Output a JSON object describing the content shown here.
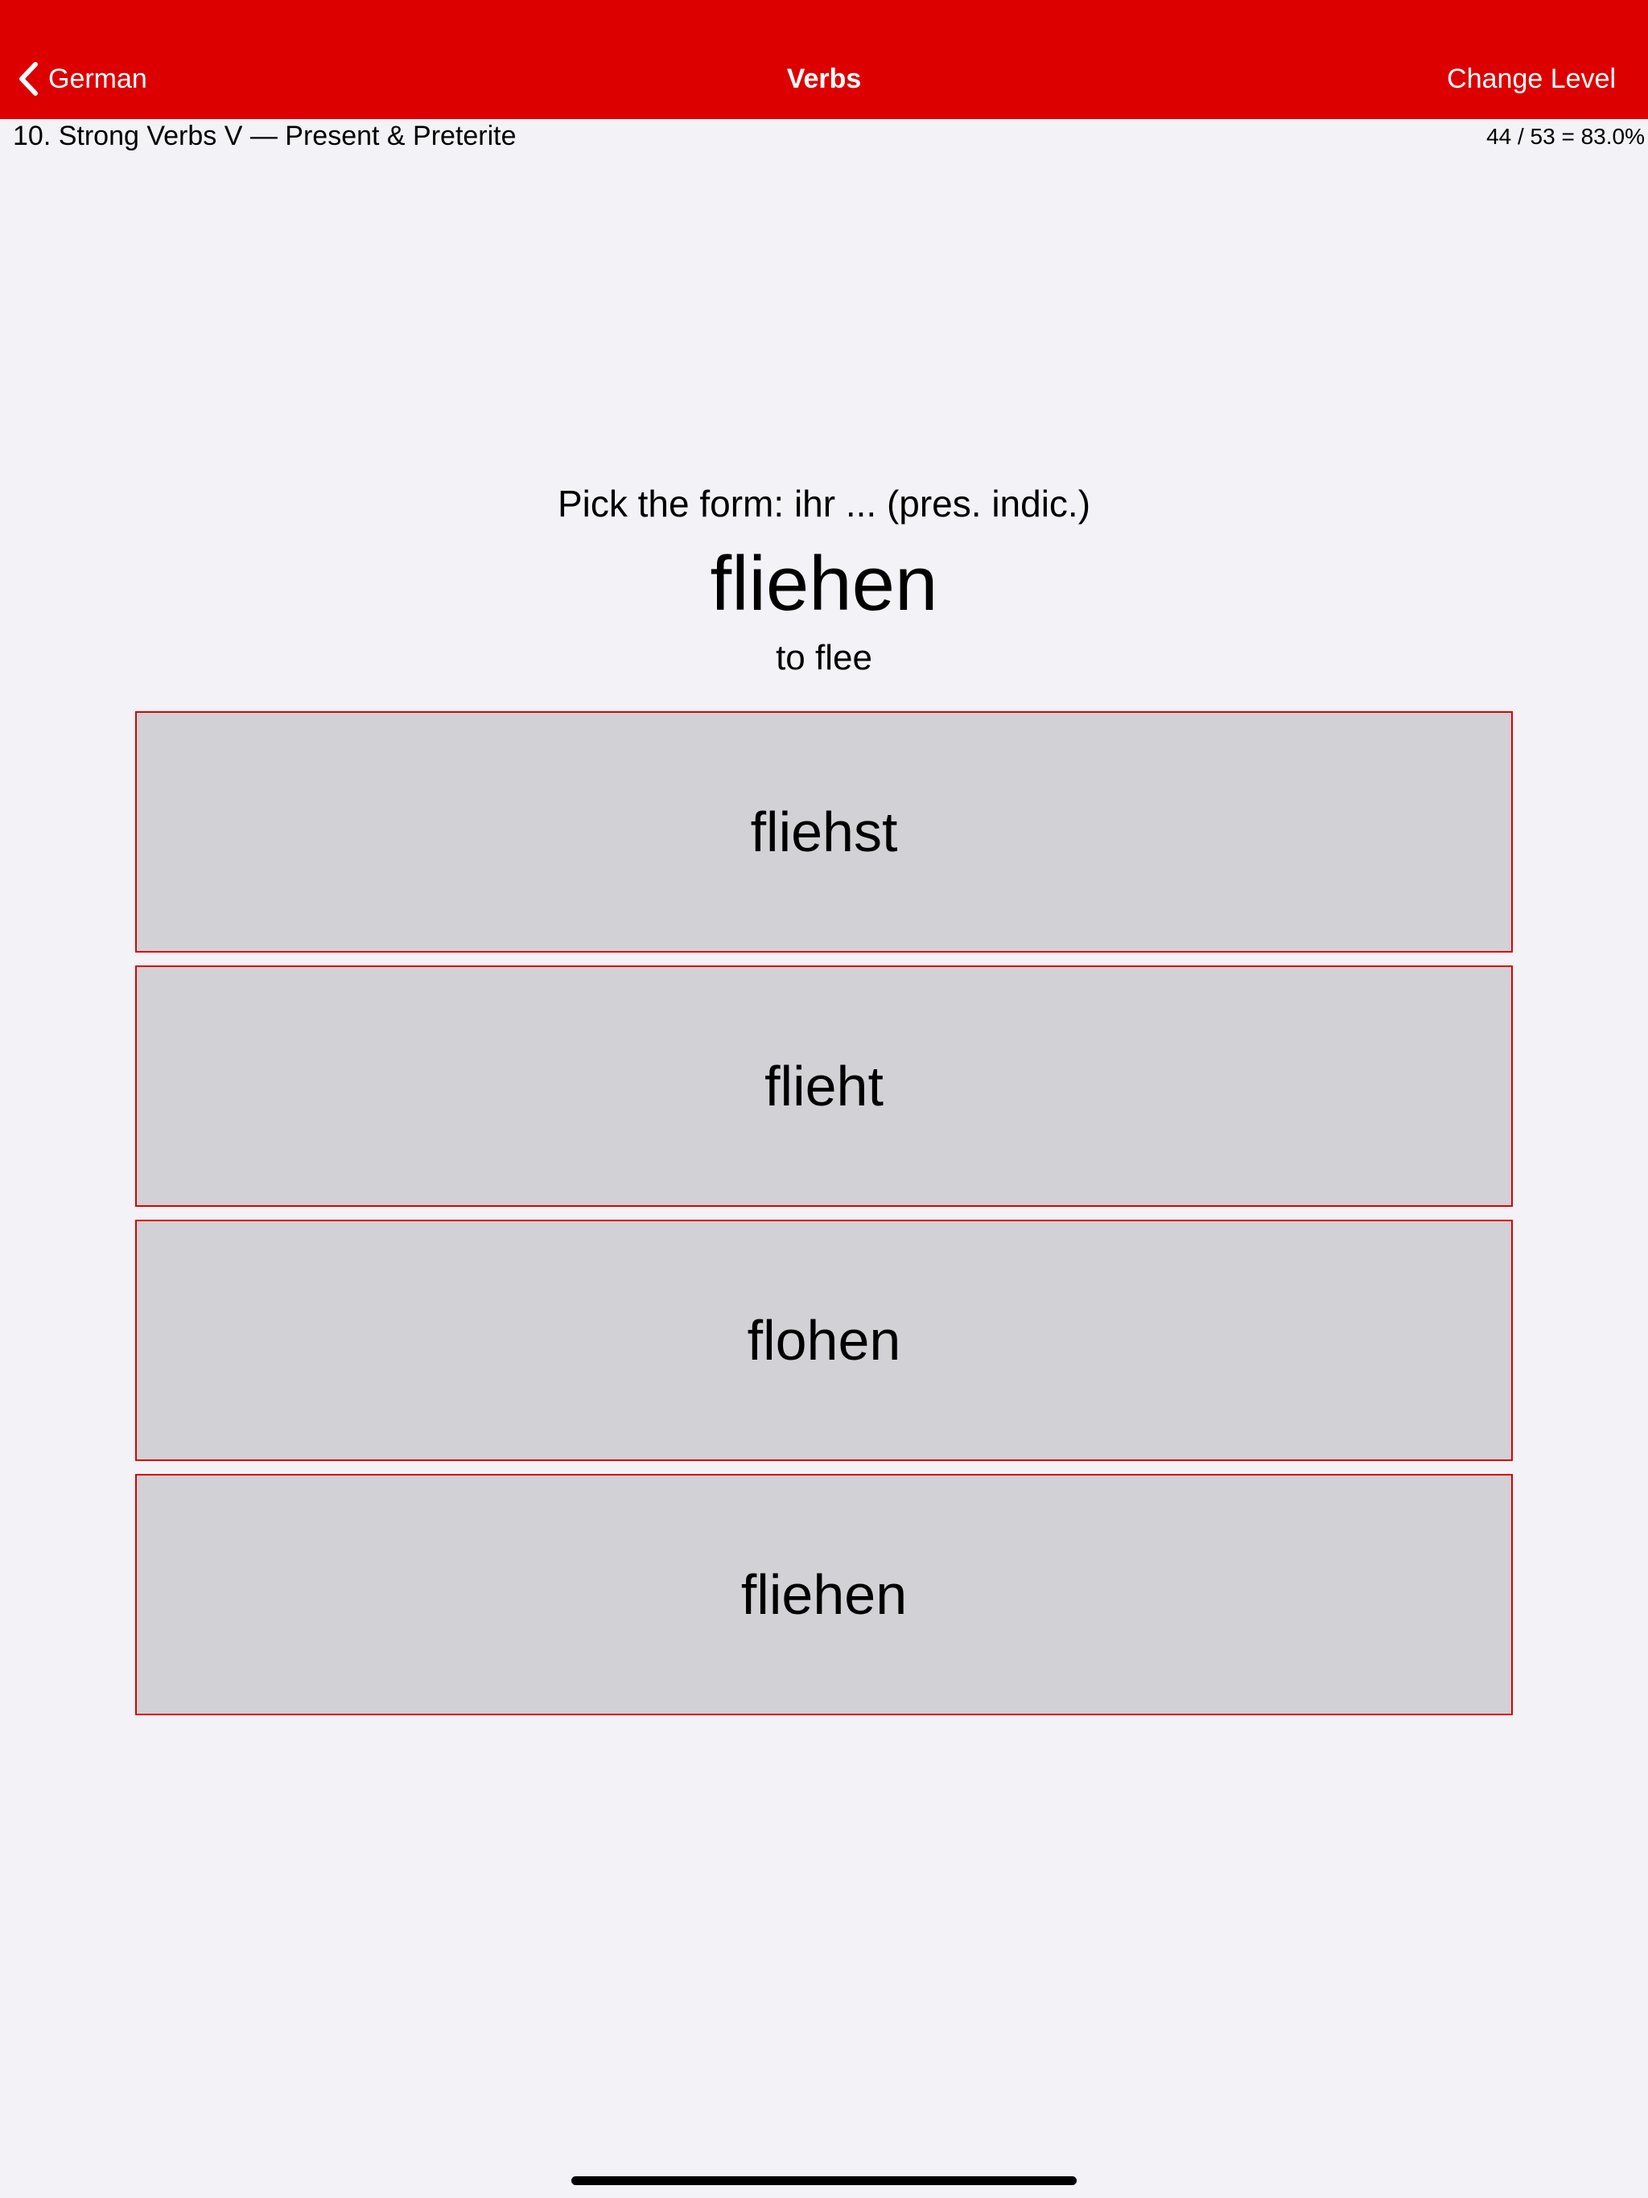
{
  "navbar": {
    "back_label": "German",
    "title": "Verbs",
    "right_label": "Change Level",
    "color": "#dd0000"
  },
  "status": {
    "lesson_title": "10. Strong Verbs V — Present & Preterite",
    "score": "44 / 53 = 83.0%"
  },
  "quiz": {
    "prompt": "Pick the form: ihr ... (pres. indic.)",
    "headword": "fliehen",
    "gloss": "to flee",
    "answers": [
      "fliehst",
      "flieht",
      "flohen",
      "fliehen"
    ]
  },
  "icons": {
    "back": "chevron-left-icon"
  }
}
